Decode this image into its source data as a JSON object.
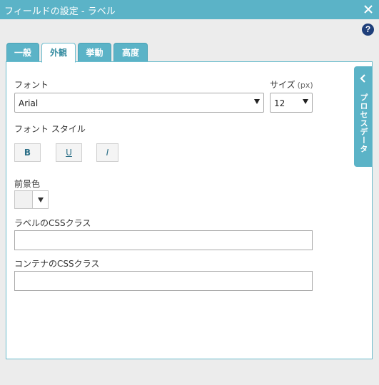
{
  "window": {
    "title": "フィールドの設定 - ラベル"
  },
  "tabs": [
    {
      "label": "一般"
    },
    {
      "label": "外観"
    },
    {
      "label": "挙動"
    },
    {
      "label": "高度"
    }
  ],
  "active_tab": "外観",
  "font": {
    "label": "フォント",
    "value": "Arial"
  },
  "size": {
    "label": "サイズ",
    "unit": "(px)",
    "value": "12"
  },
  "font_style": {
    "label": "フォント スタイル",
    "bold": "B",
    "underline": "U",
    "italic": "I"
  },
  "foreground": {
    "label": "前景色"
  },
  "label_css": {
    "label": "ラベルのCSSクラス",
    "value": ""
  },
  "container_css": {
    "label": "コンテナのCSSクラス",
    "value": ""
  },
  "side_panel": {
    "label": "プロセスデータ"
  },
  "colors": {
    "accent": "#5bb3c7",
    "help": "#1f3f7a"
  }
}
